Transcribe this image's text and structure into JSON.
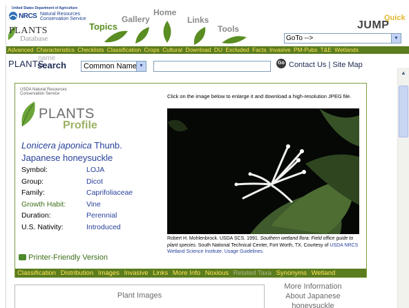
{
  "header": {
    "usda_line": "United States Department of Agriculture",
    "nrcs": "NRCS",
    "nrcs_sub_1": "Natural Resources",
    "nrcs_sub_2": "Conservation Service",
    "plants": "PLANTS",
    "database": "Database",
    "nav": {
      "topics": "Topics",
      "gallery": "Gallery",
      "home": "Home",
      "links": "Links",
      "tools": "Tools"
    },
    "quick": "Quick",
    "jump": "JUMP",
    "goto_value": "GoTo -->"
  },
  "greenbar": [
    "Advanced",
    "Characteristics",
    "Checklists",
    "Classification",
    "Crops",
    "Cultural",
    "Download",
    "DU",
    "Excluded",
    "Facts",
    "Invasive",
    "PM-Pubs",
    "T&E",
    "Wetlands"
  ],
  "search": {
    "plants_label": "PLANTS",
    "name_label": "name",
    "search_label": "search",
    "select_value": "Common Name",
    "input_value": "",
    "go_label": "Go",
    "contact": "Contact Us | Site Map"
  },
  "profile": {
    "usda_line": "USDA Natural Resources",
    "nrcs_line": "Conservation Service",
    "plants": "PLANTS",
    "profile": "Profile",
    "sci_genus_species": "Lonicera japonica",
    "sci_author": "Thunb.",
    "common_name": "Japanese honeysuckle",
    "facts": [
      {
        "label": "Symbol:",
        "value": "LOJA"
      },
      {
        "label": "Group:",
        "value": "Dicot"
      },
      {
        "label": "Family:",
        "value": "Caprifoliaceae"
      },
      {
        "label": "Growth Habit:",
        "value": "Vine"
      },
      {
        "label": "Duration:",
        "value": "Perennial"
      },
      {
        "label": "U.S. Nativity:",
        "value": "Introduced"
      }
    ],
    "printer_link": "Printer-Friendly Version",
    "image_caption": "Click on the image below to enlarge it and download a high-resolution JPEG file.",
    "credit_plain": "Robert H. Mohlenbrock. USDA SCS. 1991.",
    "credit_italic": "Southern wetland flora: Field office guide to plant species.",
    "credit_plain_2": "South National Technical Center, Fort Worth, TX. Courtesy of",
    "credit_link": "USDA NRCS Wetland Science Institute.",
    "credit_guidelines": "Usage Guidelines.",
    "tabs": [
      {
        "label": "Classification",
        "dim": false
      },
      {
        "label": "Distribution",
        "dim": false
      },
      {
        "label": "Images",
        "dim": false
      },
      {
        "label": "Invasive",
        "dim": false
      },
      {
        "label": "Links",
        "dim": false
      },
      {
        "label": "More Info",
        "dim": false
      },
      {
        "label": "Noxious",
        "dim": false
      },
      {
        "label": "Related Taxa",
        "dim": true
      },
      {
        "label": "Synonyms",
        "dim": false
      },
      {
        "label": "Wetland",
        "dim": false
      }
    ]
  },
  "lower": {
    "plant_images_title": "Plant Images",
    "more_info_1": "More Information",
    "more_info_2": "About Japanese",
    "more_info_3": "honeysuckle"
  },
  "colors": {
    "green_bar": "#5b7d1e",
    "bar_text": "#ffe45a",
    "link_blue": "#27409a"
  }
}
